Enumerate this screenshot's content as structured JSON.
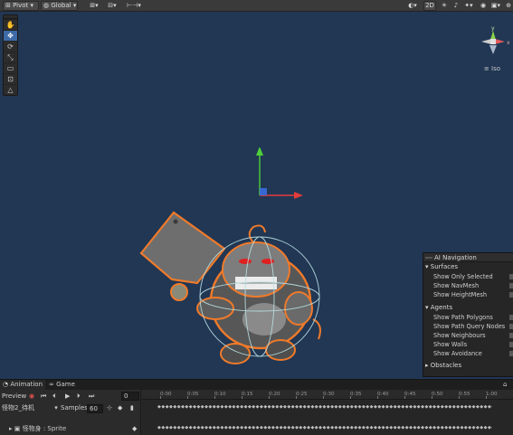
{
  "toolbar": {
    "pivot_label": "Pivot",
    "global_label": "Global",
    "mode_2d_label": "2D"
  },
  "scene": {
    "tools": [
      "hand-tool",
      "move-tool",
      "rotate-tool",
      "scale-tool",
      "rect-tool",
      "transform-tool",
      "custom-tool"
    ],
    "active_tool": "move-tool",
    "gizmo_axis_y": "y",
    "gizmo_axis_x": "x",
    "gizmo_projection": "Iso",
    "colors": {
      "background": "#213754",
      "selection_outline": "#f07a2a",
      "axis_x": "#e43b3b",
      "axis_y": "#4fcf3a",
      "axis_z": "#3a6ee0",
      "collider": "#b8dde0"
    }
  },
  "ai_navigation": {
    "title": "AI Navigation",
    "surfaces_label": "Surfaces",
    "surfaces": [
      "Show Only Selected",
      "Show NavMesh",
      "Show HeightMesh"
    ],
    "agents_label": "Agents",
    "agents": [
      "Show Path Polygons",
      "Show Path Query Nodes",
      "Show Neighbours",
      "Show Walls",
      "Show Avoidance"
    ],
    "obstacles_label": "Obstacles"
  },
  "animation": {
    "tab_animation": "Animation",
    "tab_game": "Game",
    "preview_label": "Preview",
    "frame_value": "0",
    "clip_name": "怪物2_待机",
    "samples_label": "Samples",
    "samples_value": "60",
    "track_label": "怪物身 : Sprite",
    "ruler_ticks": [
      "0:00",
      "0:05",
      "0:10",
      "0:15",
      "0:20",
      "0:25",
      "0:30",
      "0:35",
      "0:40",
      "0:45",
      "0:50",
      "0:55",
      "1:00"
    ]
  }
}
